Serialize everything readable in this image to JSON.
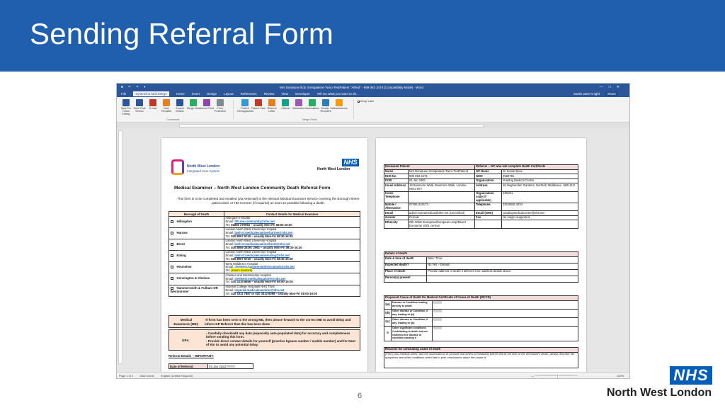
{
  "slide": {
    "title": "Sending Referral Form",
    "page_number": "6",
    "logo_text": "NHS",
    "logo_region": "North West London"
  },
  "word": {
    "window_title": "Mrs Donatuse Bob Xrestpatient-Twiro-TestPatient \"Alfred\" - 999 053 3474 [Compatibility Mode] - Word",
    "tabs": [
      "File",
      "SystmOne Mail Merge",
      "Home",
      "Insert",
      "Design",
      "Layout",
      "References",
      "Review",
      "View",
      "Developer"
    ],
    "active_tab": "SystmOne Mail Merge",
    "tell_me": "Tell me what you want to do...",
    "user_name": "Sarah Jane Knight",
    "share_label": "Share",
    "ribbon": [
      {
        "icon": "save-icon",
        "label": "Save For Future Editing"
      },
      {
        "icon": "save-final-icon",
        "label": "Save Final Version"
      },
      {
        "icon": "email-icon",
        "label": "E-mail"
      },
      {
        "icon": "new-template-icon",
        "label": "New Template"
      },
      {
        "icon": "amend-icon",
        "label": "Amend Details"
      },
      {
        "icon": "merge-icon",
        "label": "Merge Now"
      },
      {
        "icon": "amend-field-icon",
        "label": "Amend Field"
      },
      {
        "icon": "protection-icon",
        "label": "Form Protection"
      },
      {
        "icon": "patient-icon",
        "label": "Patient Demographics"
      },
      {
        "icon": "care-icon",
        "label": "Patient Care"
      },
      {
        "icon": "letter-icon",
        "label": "Referral Letter"
      },
      {
        "icon": "clinical-icon",
        "label": "Clinical"
      },
      {
        "icon": "medication-icon",
        "label": "Medication"
      },
      {
        "icon": "vaccination-icon",
        "label": "Vaccinations"
      },
      {
        "icon": "recipient-icon",
        "label": "Sender / Recipient"
      },
      {
        "icon": "misc-icon",
        "label": "Miscellaneous"
      }
    ],
    "merge_later": "Merge Later",
    "group_commands": "Commands",
    "group_merge_fields": "Merge Fields",
    "status": {
      "page": "Page 1 of 1",
      "words": "1862 words",
      "language": "English (United Kingdom)",
      "zoom": "100%"
    }
  },
  "form": {
    "org": "North West London",
    "org_sub": "Integrated Care System",
    "nhs": "NHS",
    "nhs_region": "North West London",
    "title": "Medical Examiner – North West London Community Death Referral Form",
    "intro": "This form is to be completed and emailed (via NHSmail) to the relevant Medical Examiner Service covering the Borough where patient died, or HM Coroner (if required) as soon as possible following a death.",
    "borough_header": "Borough of Death",
    "contact_header": "Contact Details for Medical Examiner",
    "boroughs": [
      {
        "name": "Hillingdon",
        "hospital": "Hillingdon Hospital",
        "email": "thh.me-community@nhs.net",
        "tel": "01895 279953 – usually Mon-Fri 08:00-16:00"
      },
      {
        "name": "Harrow",
        "hospital": "London North West University Hospital",
        "email": "lnwh-tr.medicalexaminerharrow@nhs.net",
        "tel": "020 8967 5740 – usually Mon-Fri 08:30-16:30"
      },
      {
        "name": "Brent",
        "hospital": "London North West University Hospital",
        "email": "lnwh-tr.medicalexaminerbrent@nhs.net",
        "tel": "020 8869 2539 / 2961 – usually Mon-Fri 08:30-16:30"
      },
      {
        "name": "Ealing",
        "hospital": "London North West University Hospital",
        "email": "lnwh-tr.medicalexamineraling@nhs.net",
        "tel": "020 8967 5740 – usually Mon-Fri 08:30-16:30"
      },
      {
        "name": "Hounslow",
        "hospital": "West Middlesex Hospital",
        "email": "chelwest.hammersmithsm.wmuh@nhs.net",
        "tel": "(Hours manned)"
      },
      {
        "name": "Kensington & Chelsea",
        "hospital": "Chelsea and Westminster Hospital",
        "email": "chelwest.medicalexaminer@nhs.net",
        "tel": "020 3315 8658 – usually Mon-Fri 08:00-16:00"
      },
      {
        "name": "Hammersmith & Fulham OR Westminster",
        "hospital": "Imperial College Hospitals NHS Trust",
        "email": "imperial.medicalexaminer@nhs.net",
        "tel": "020 3311 7887 or 020 3312 6068 – usually Mon-Fri 08:00-16:00"
      }
    ],
    "hospital_label": "Email:",
    "tel_label": "Tel:",
    "me_label": "Medical Examiners (ME):",
    "me_text": "-If form has been sent to the wrong ME, then please forward to the correct ME to avoid delay and inform GP Referrer that this has been done.",
    "gps_label": "GPs:",
    "gps_items": [
      "Carefully check/edit any data (especially auto-populated data) for accuracy and completeness before sending this form.",
      "Provide direct contact details for yourself (practice bypass number / mobile number) and for Next of Kin to avoid any potential delay."
    ],
    "referral_header": "Referral Details – IMPORTANT:",
    "date_of_referral_label": "Date of Referral",
    "date_of_referral": "03 Jan 2023"
  },
  "page2": {
    "deceased_header": "Deceased Patient",
    "gp_header": "Referrer – GP who will complete Death Certificate",
    "rows": [
      {
        "l": "Name",
        "v": "Mrs Donatuse Xrestpatient-Twiro-TestPatient",
        "l2": "GP Name",
        "v2": "Dr Sonali Bose"
      },
      {
        "l": "NHS No",
        "v": "999 053 3474",
        "l2": "GMC",
        "v2": "4569791"
      },
      {
        "l": "DOB",
        "v": "01 Jan 1981",
        "l2": "Organisation",
        "v2": "Yeading Medical Centre"
      },
      {
        "l": "Usual Address",
        "v": "18 Bowmore Walk, Bowmore Walk, London, NW1 9XY",
        "l2": "Address",
        "v2": "18 Hughenden Gardens, Northolt, Middlesex, UB5 6LD"
      },
      {
        "l": "Home Telephone",
        "v": "",
        "l2": "Organisation code (if applicable)",
        "v2": "E85621"
      },
      {
        "l": "Mobile / Alternative",
        "v": "07496 318173",
        "l2": "Telephone",
        "v2": "020 8845 3434"
      },
      {
        "l": "Email",
        "v": "admin.surnamedical@nhs.net (Unverified)",
        "l2": "Email (NHS)",
        "v2": "yeadingmedicalcentre@nhs.net"
      },
      {
        "l": "Gender",
        "v": "Female",
        "l2": "Fax",
        "v2": "No longer supported"
      },
      {
        "l": "Ethnicity",
        "v": "Oth White European/European unsp/Mixed European 2001 census",
        "l2": "",
        "v2": ""
      }
    ],
    "death_header": "Details of death",
    "death_rows": [
      {
        "l": "Date & time of death",
        "v": "Date:        Time:"
      },
      {
        "l": "Expected death?",
        "v": "No                    Yes – Details:"
      },
      {
        "l": "Place of death",
        "v": "Provide address of death if different from address details above:"
      },
      {
        "l": "Person(s) present",
        "v": ""
      }
    ],
    "mccd_header": "Proposed Cause of Death for Medical Certificate of Cause of Death (MCCD)",
    "mccd_rows": [
      {
        "l": "I(a)",
        "v": "Disease or Condition leading directly to death"
      },
      {
        "l": "I(b)",
        "v": "Other disease or Condition, if any, leading to I(a)"
      },
      {
        "l": "I(c)",
        "v": "Other disease or Condition, if any, leading to I(b)"
      },
      {
        "l": "II",
        "v": "Other significant conditions Contributing to death but not related to the disease or condition causing it"
      }
    ],
    "reasons_header": "Reasons for concluding cause of death",
    "reasons_text": "(From your medical notes, and the observations of yourself and others immediately before and at the time of the deceased's death, please describe the symptoms and other conditions which led to your conclusions about the cause of"
  }
}
